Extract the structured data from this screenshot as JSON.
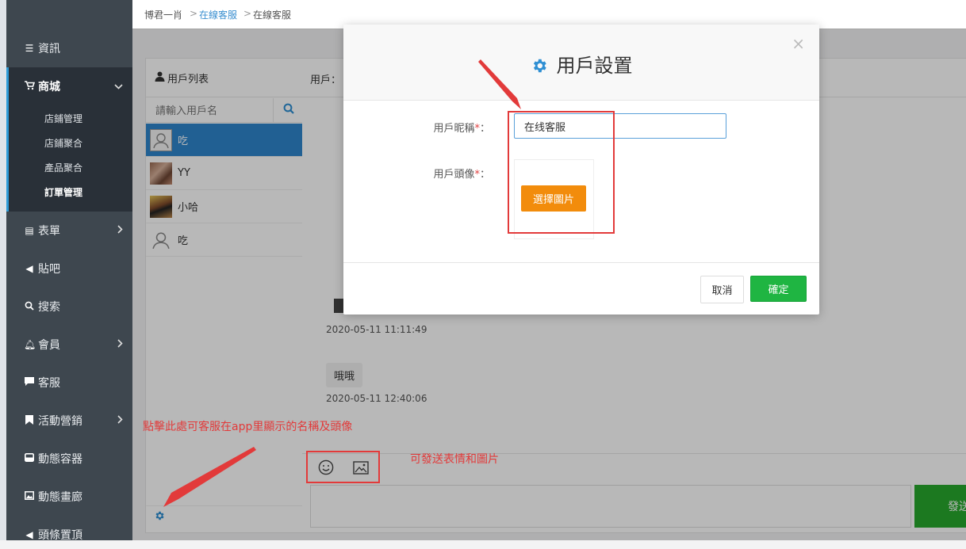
{
  "breadcrumb": {
    "home": "博君一肖",
    "section": "在線客服",
    "current": "在線客服"
  },
  "sidebar": {
    "items": [
      {
        "label": "資訊",
        "icon": "list-icon"
      },
      {
        "label": "商城",
        "icon": "cart-icon"
      },
      {
        "label": "表單",
        "icon": "form-icon"
      },
      {
        "label": "貼吧",
        "icon": "megaphone-icon"
      },
      {
        "label": "搜索",
        "icon": "search-icon"
      },
      {
        "label": "會員",
        "icon": "bell-icon"
      },
      {
        "label": "客服",
        "icon": "chat-icon"
      },
      {
        "label": "活動營銷",
        "icon": "bookmark-icon"
      },
      {
        "label": "動態容器",
        "icon": "inbox-icon"
      },
      {
        "label": "動態畫廊",
        "icon": "image-icon"
      },
      {
        "label": "頭條置頂",
        "icon": "megaphone-icon"
      }
    ],
    "shop_sub": [
      "店鋪管理",
      "店鋪聚合",
      "產品聚合",
      "訂單管理"
    ]
  },
  "user_panel": {
    "title": "用戶列表",
    "search_placeholder": "請輸入用戶名",
    "users": [
      "吃",
      "YY",
      "小哈",
      "吃"
    ]
  },
  "chat": {
    "header_label": "用戶：",
    "messages": [
      {
        "time": "2020-05-11 11:11:49"
      },
      {
        "text": "哦哦",
        "time": "2020-05-11 12:40:06"
      }
    ],
    "send_label": "發送"
  },
  "modal": {
    "title": "用戶設置",
    "nickname_label": "用戶昵稱",
    "nickname_value": "在线客服",
    "avatar_label": "用戶頭像",
    "required_mark": "*",
    "label_suffix": "：",
    "choose_image": "選擇圖片",
    "cancel": "取消",
    "confirm": "確定",
    "close": "×"
  },
  "annotations": {
    "settings_hint": "點擊此處可客服在app里顯示的名稱及頭像",
    "send_hint": "可發送表情和圖片"
  },
  "colors": {
    "accent": "#2f86cc",
    "confirm": "#1fb542",
    "choose": "#f28c0c",
    "annotation": "#e23a3a",
    "sidebar": "#3e474f"
  }
}
